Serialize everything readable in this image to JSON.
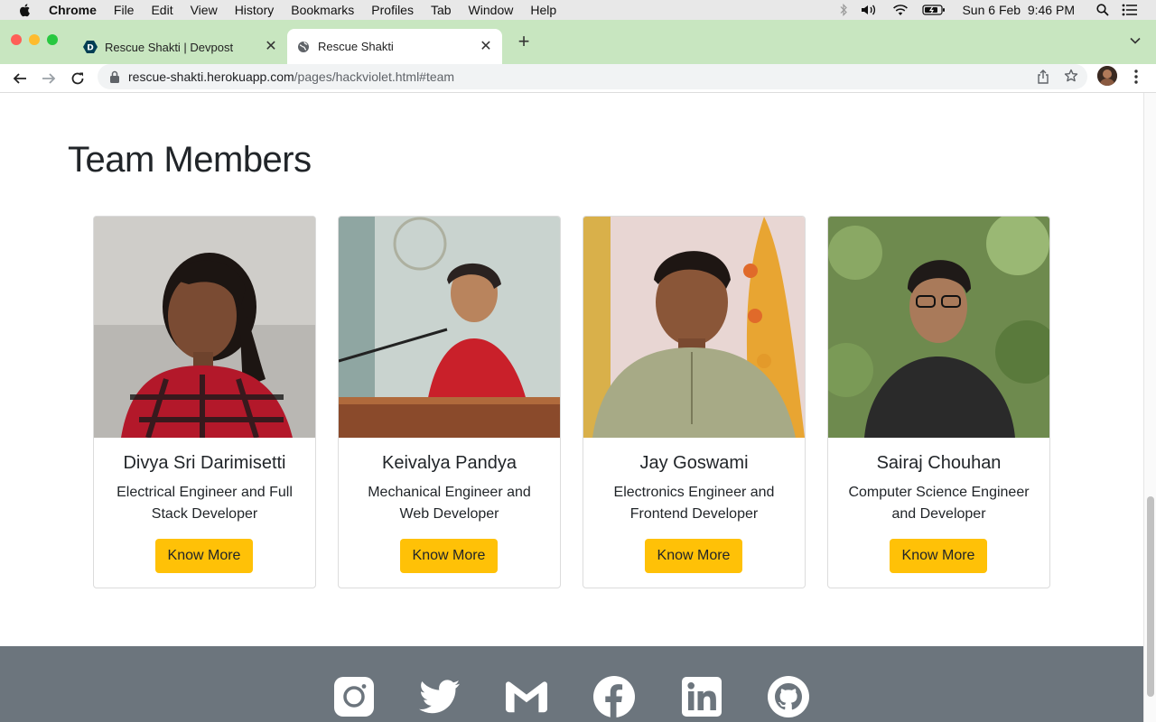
{
  "menubar": {
    "app": "Chrome",
    "items": [
      "File",
      "Edit",
      "View",
      "History",
      "Bookmarks",
      "Profiles",
      "Tab",
      "Window",
      "Help"
    ],
    "clock": "Sun 6 Feb  9:46 PM"
  },
  "tabs": [
    {
      "title": "Rescue Shakti | Devpost",
      "favicon": "devpost-icon",
      "active": false
    },
    {
      "title": "Rescue Shakti",
      "favicon": "globe-icon",
      "active": true
    }
  ],
  "address_bar": {
    "host": "rescue-shakti.herokuapp.com",
    "path": "/pages/hackviolet.html#team"
  },
  "section": {
    "title": "Team Members"
  },
  "team": [
    {
      "name": "Divya Sri Darimisetti",
      "role": "Electrical Engineer and Full Stack Developer",
      "button": "Know More"
    },
    {
      "name": "Keivalya Pandya",
      "role": "Mechanical Engineer and Web Developer",
      "button": "Know More"
    },
    {
      "name": "Jay Goswami",
      "role": "Electronics Engineer and Frontend Developer",
      "button": "Know More"
    },
    {
      "name": "Sairaj Chouhan",
      "role": "Computer Science Engineer and Developer",
      "button": "Know More"
    }
  ],
  "footer": {
    "social_icons": [
      "instagram-icon",
      "twitter-icon",
      "gmail-icon",
      "facebook-icon",
      "linkedin-icon",
      "github-icon"
    ]
  },
  "colors": {
    "accent_button": "#ffc107",
    "footer_bg": "#6c757d",
    "tabstrip_bg": "#c8e6c0"
  }
}
